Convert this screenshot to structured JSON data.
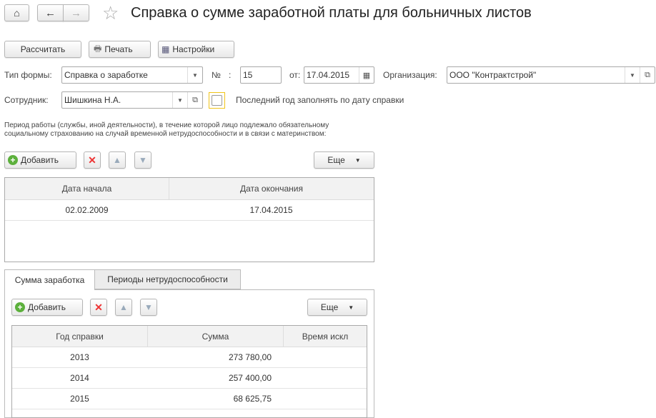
{
  "title": "Справка о сумме заработной платы для больничных листов",
  "toolbar": {
    "calculate": "Рассчитать",
    "print": "Печать",
    "settings": "Настройки"
  },
  "form": {
    "type_label": "Тип формы:",
    "type_value": "Справка о заработке",
    "number_label": "№",
    "number_colon": ":",
    "number_value": "15",
    "date_label": "от:",
    "date_value": "17.04.2015",
    "org_label": "Организация:",
    "org_value": "ООО \"Контрактстрой\"",
    "employee_label": "Сотрудник:",
    "employee_value": "Шишкина Н.А.",
    "last_year_label": "Последний год заполнять по дату справки",
    "period_note": "Период работы (службы, иной деятельности), в течение которой лицо подлежало обязательному социальному страхованию на случай временной нетрудоспособности и в связи с материнством:"
  },
  "periods": {
    "add": "Добавить",
    "more": "Еще",
    "columns": [
      "Дата начала",
      "Дата окончания"
    ],
    "rows": [
      [
        "02.02.2009",
        "17.04.2015"
      ]
    ]
  },
  "tabs": [
    {
      "label": "Сумма заработка",
      "active": true
    },
    {
      "label": "Периоды нетрудоспособности",
      "active": false
    }
  ],
  "earnings": {
    "add": "Добавить",
    "more": "Еще",
    "columns": [
      "Год справки",
      "Сумма",
      "Время искл"
    ],
    "rows": [
      [
        "2013",
        "273 780,00",
        ""
      ],
      [
        "2014",
        "257 400,00",
        ""
      ],
      [
        "2015",
        "68 625,75",
        ""
      ]
    ]
  }
}
